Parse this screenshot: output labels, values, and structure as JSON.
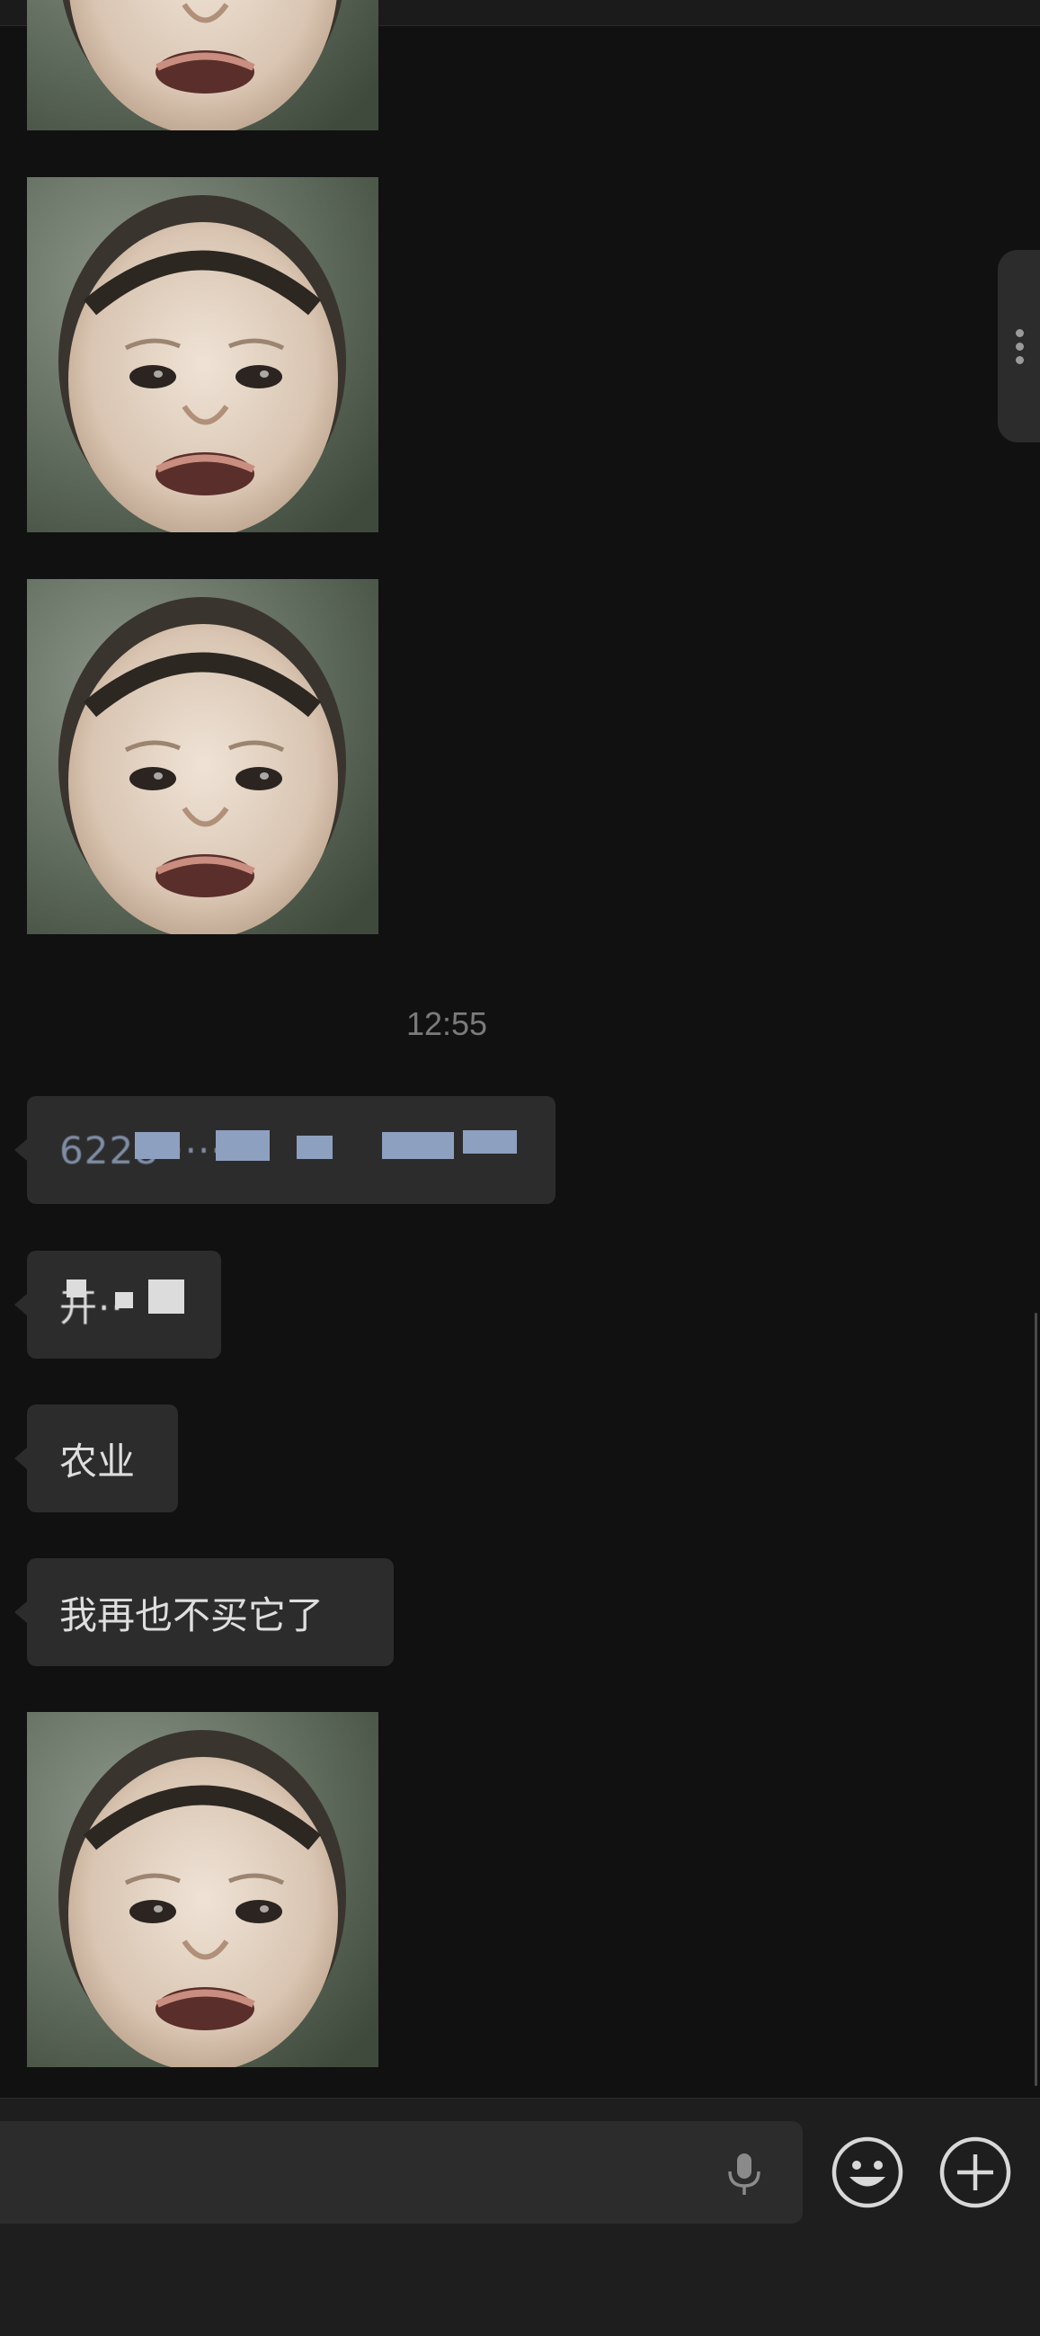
{
  "chat": {
    "timestamp": "12:55",
    "messages": [
      {
        "kind": "text",
        "text": "6228·····"
      },
      {
        "kind": "text",
        "text": "开··"
      },
      {
        "kind": "text",
        "text": "农业"
      },
      {
        "kind": "text",
        "text": "我再也不买它了"
      }
    ]
  },
  "photo_subject": "crying-toddler-sticker",
  "input": {
    "value": "",
    "placeholder": ""
  },
  "icons": [
    "microphone-icon",
    "emoji-icon",
    "plus-icon",
    "more-dots-icon"
  ],
  "colors": {
    "background": "#111111",
    "bubble": "#2c2c2c",
    "input_bar": "#1e1e1e",
    "timestamp": "#7b7b7b"
  }
}
